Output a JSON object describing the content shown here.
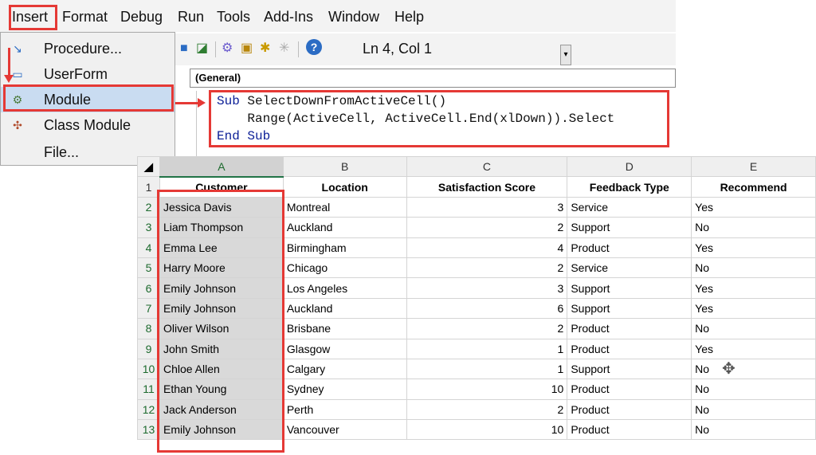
{
  "menubar": {
    "items": [
      "Insert",
      "Format",
      "Debug",
      "Run",
      "Tools",
      "Add-Ins",
      "Window",
      "Help"
    ]
  },
  "toolbar": {
    "status": "Ln 4, Col 1",
    "icons": [
      "design-mode-icon",
      "project-explorer-icon",
      "properties-icon",
      "object-browser-icon",
      "toolbox-icon",
      "help-icon"
    ]
  },
  "insert_menu": {
    "items": [
      {
        "label": "Procedure...",
        "icon": "procedure-icon"
      },
      {
        "label": "UserForm",
        "icon": "userform-icon"
      },
      {
        "label": "Module",
        "icon": "module-icon",
        "selected": true
      },
      {
        "label": "Class Module",
        "icon": "class-module-icon"
      },
      {
        "label": "File...",
        "icon": ""
      }
    ]
  },
  "editor": {
    "object_box": "(General)",
    "code": {
      "line1_kw": "Sub",
      "line1_rest": " SelectDownFromActiveCell()",
      "line2": "    Range(ActiveCell, ActiveCell.End(xlDown)).Select",
      "line3_kw": "End Sub"
    }
  },
  "sheet": {
    "columns": [
      "A",
      "B",
      "C",
      "D",
      "E"
    ],
    "headers": [
      "Customer",
      "Location",
      "Satisfaction Score",
      "Feedback Type",
      "Recommend"
    ],
    "rows": [
      [
        "2",
        "Jessica Davis",
        "Montreal",
        "3",
        "Service",
        "Yes"
      ],
      [
        "3",
        "Liam Thompson",
        "Auckland",
        "2",
        "Support",
        "No"
      ],
      [
        "4",
        "Emma Lee",
        "Birmingham",
        "4",
        "Product",
        "Yes"
      ],
      [
        "5",
        "Harry Moore",
        "Chicago",
        "2",
        "Service",
        "No"
      ],
      [
        "6",
        "Emily Johnson",
        "Los Angeles",
        "3",
        "Support",
        "Yes"
      ],
      [
        "7",
        "Emily Johnson",
        "Auckland",
        "6",
        "Support",
        "Yes"
      ],
      [
        "8",
        "Oliver Wilson",
        "Brisbane",
        "2",
        "Product",
        "No"
      ],
      [
        "9",
        "John Smith",
        "Glasgow",
        "1",
        "Product",
        "Yes"
      ],
      [
        "10",
        "Chloe Allen",
        "Calgary",
        "1",
        "Support",
        "No"
      ],
      [
        "11",
        "Ethan Young",
        "Sydney",
        "10",
        "Product",
        "No"
      ],
      [
        "12",
        "Jack Anderson",
        "Perth",
        "2",
        "Product",
        "No"
      ],
      [
        "13",
        "Emily Johnson",
        "Vancouver",
        "10",
        "Product",
        "No"
      ]
    ]
  },
  "colors": {
    "highlight": "#e53935",
    "selection": "#d9d9d9",
    "code_keyword": "#0b1e96",
    "menu_selected": "#c9dcf1"
  }
}
